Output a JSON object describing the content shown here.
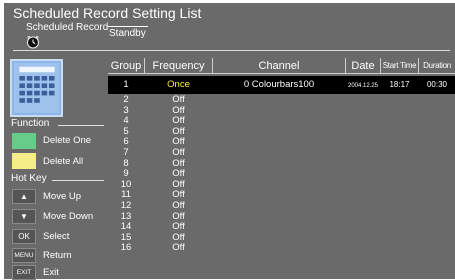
{
  "header": {
    "title": "Scheduled Record Setting List",
    "sub_label": "Scheduled Record",
    "status": "Standby"
  },
  "function_panel": {
    "heading": "Function",
    "delete_one": "Delete One",
    "delete_all": "Delete All",
    "colors": {
      "delete_one": "#66cc88",
      "delete_all": "#f5ee88"
    }
  },
  "hotkey_panel": {
    "heading": "Hot Key",
    "items": [
      {
        "key": "▲",
        "label": "Move Up"
      },
      {
        "key": "▼",
        "label": "Move Down"
      },
      {
        "key": "OK",
        "label": "Select"
      },
      {
        "key": "MENU",
        "label": "Return"
      },
      {
        "key": "EXIT",
        "label": "Exit"
      }
    ]
  },
  "table": {
    "headers": {
      "group": "Group",
      "frequency": "Frequency",
      "channel": "Channel",
      "date": "Date",
      "start_time": "Start Time",
      "duration": "Duration"
    },
    "selected_row": {
      "group": "1",
      "frequency": "Once",
      "channel": "0 Colourbars100",
      "date": "2004.12.25",
      "start_time": "18:17",
      "duration": "00:30"
    },
    "rows": [
      {
        "group": "2",
        "frequency": "Off"
      },
      {
        "group": "3",
        "frequency": "Off"
      },
      {
        "group": "4",
        "frequency": "Off"
      },
      {
        "group": "5",
        "frequency": "Off"
      },
      {
        "group": "6",
        "frequency": "Off"
      },
      {
        "group": "7",
        "frequency": "Off"
      },
      {
        "group": "8",
        "frequency": "Off"
      },
      {
        "group": "9",
        "frequency": "Off"
      },
      {
        "group": "10",
        "frequency": "Off"
      },
      {
        "group": "11",
        "frequency": "Off"
      },
      {
        "group": "12",
        "frequency": "Off"
      },
      {
        "group": "13",
        "frequency": "Off"
      },
      {
        "group": "14",
        "frequency": "Off"
      },
      {
        "group": "15",
        "frequency": "Off"
      },
      {
        "group": "16",
        "frequency": "Off"
      }
    ],
    "colors": {
      "selected_frequency": "#ffee33"
    }
  }
}
